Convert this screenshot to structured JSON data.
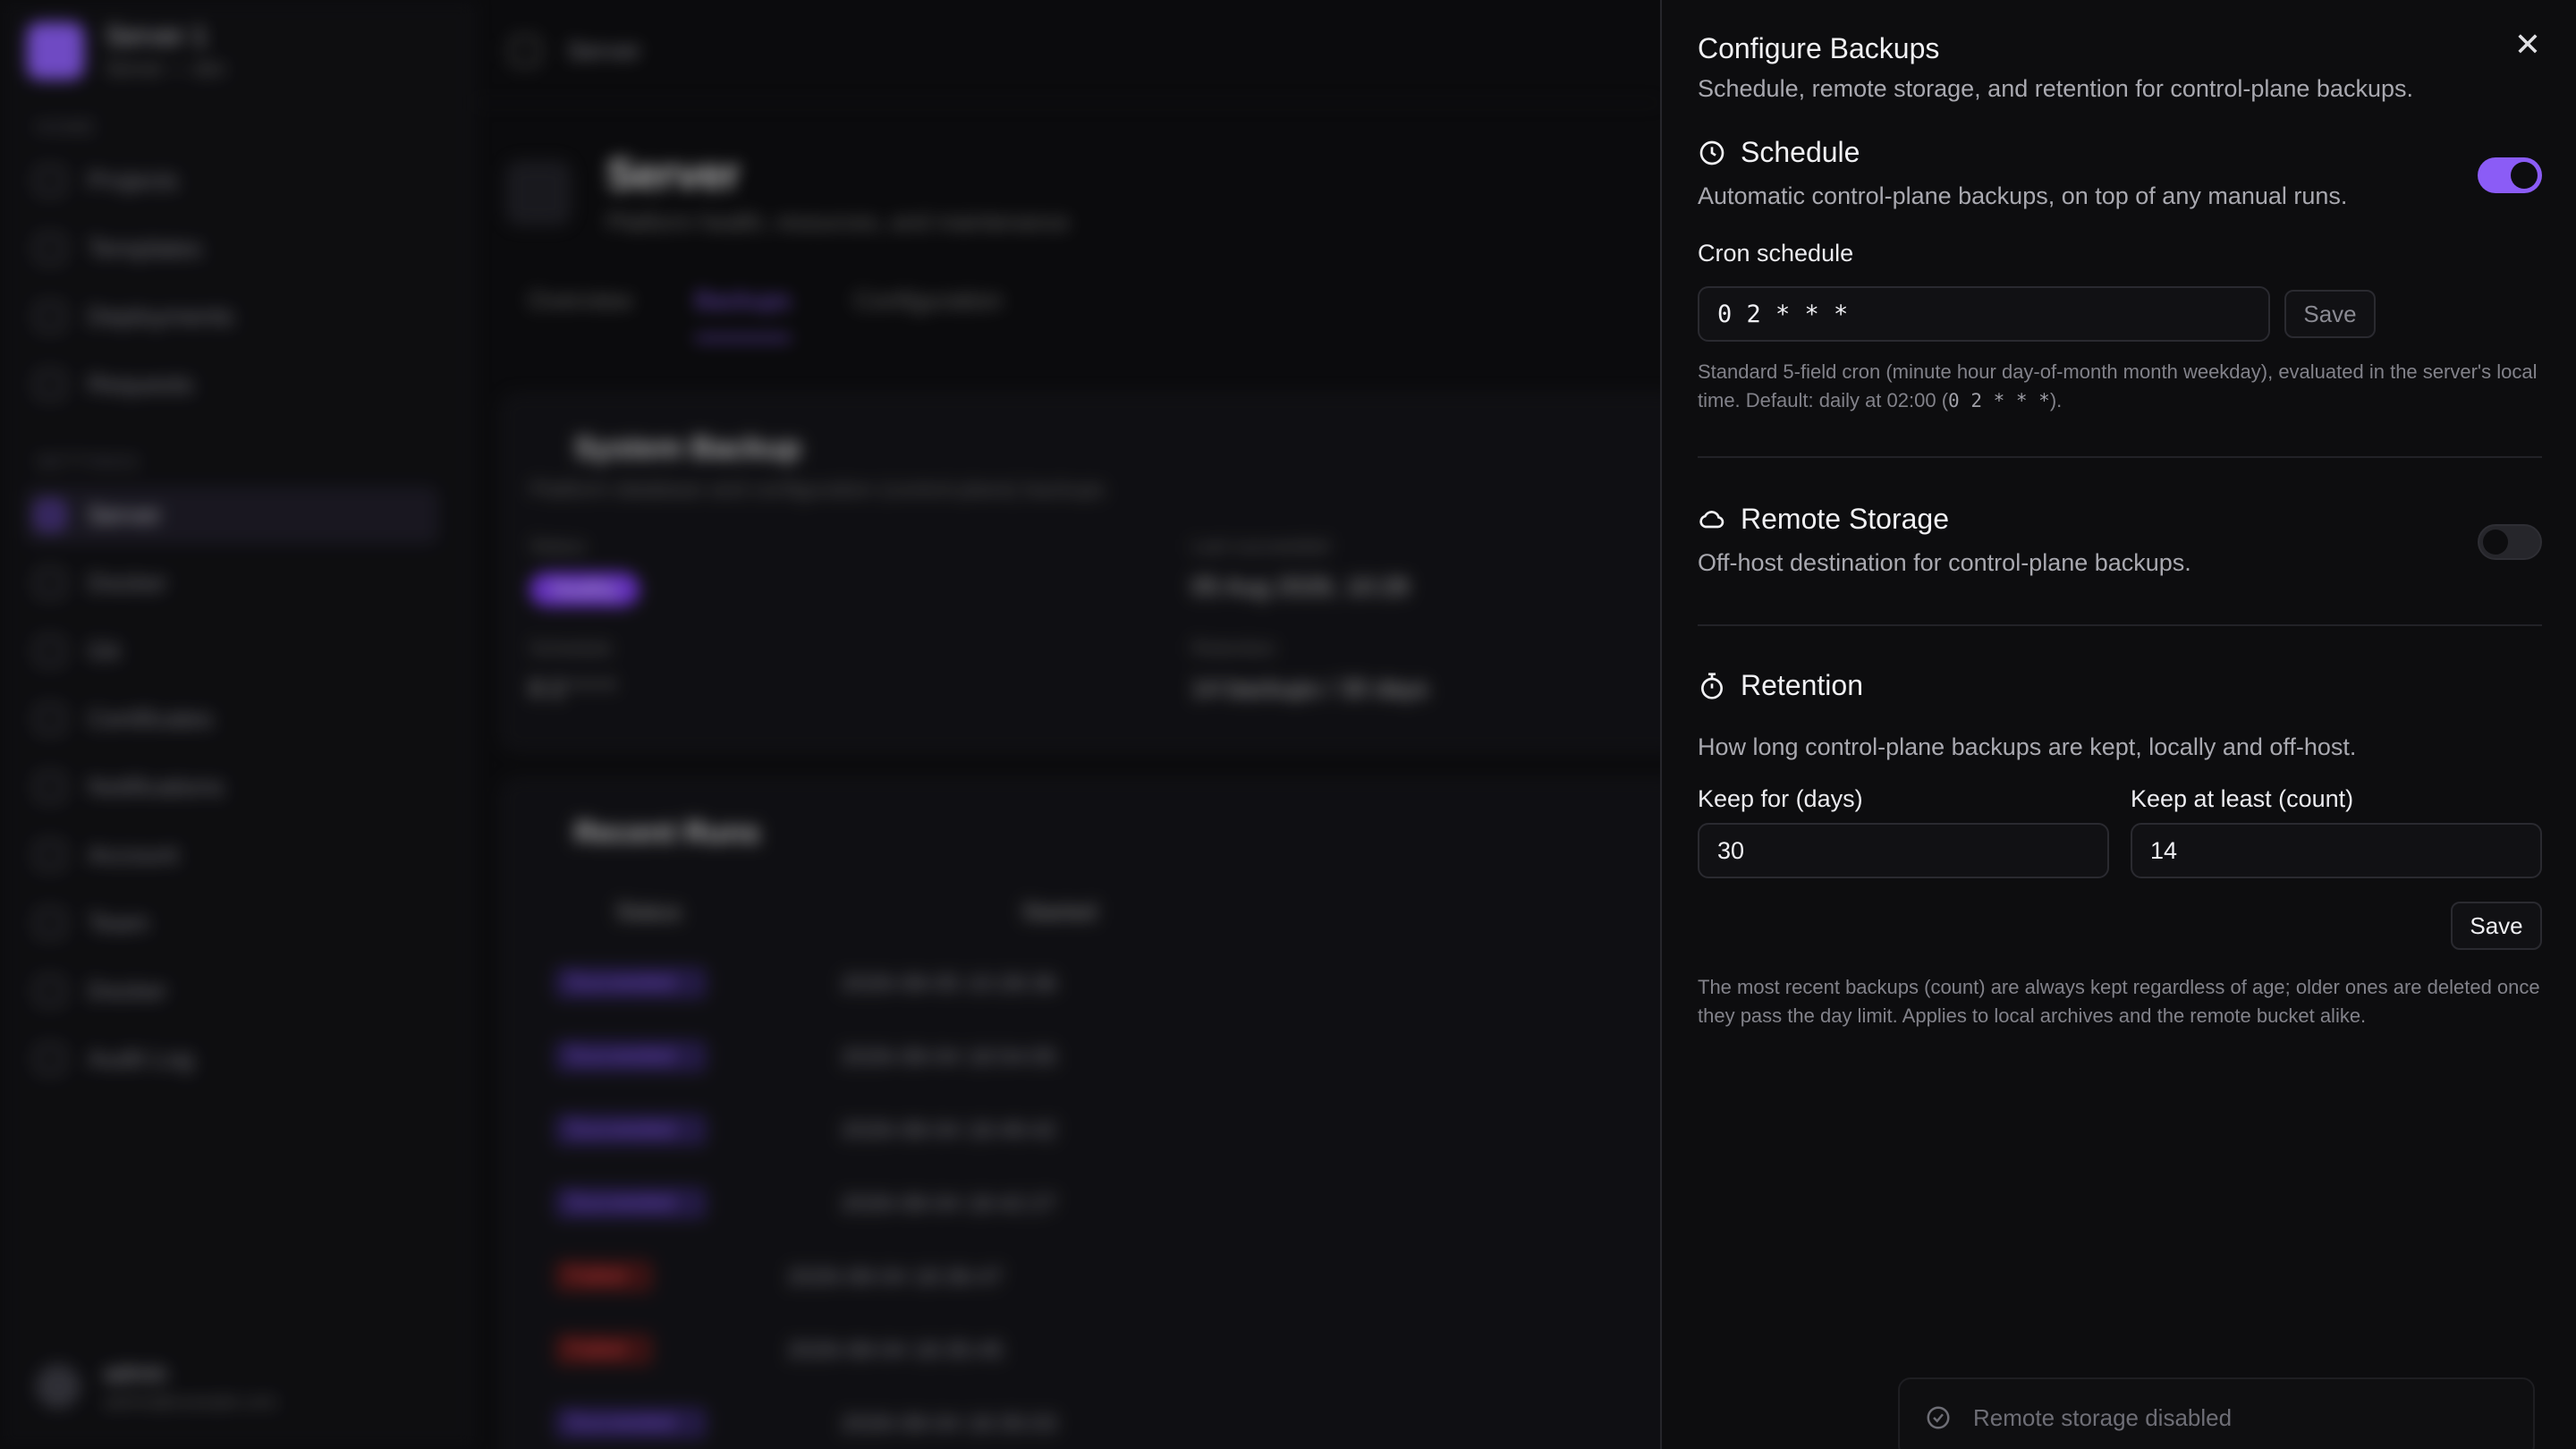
{
  "background": {
    "workspace": {
      "name": "Server 1",
      "sub": "Server — dev"
    },
    "sidebar": {
      "section_home": "HOME",
      "section_settings": "SETTINGS",
      "items_home": [
        {
          "label": "Projects",
          "icon": "folder-icon"
        },
        {
          "label": "Templates",
          "icon": "template-icon"
        },
        {
          "label": "Deployments",
          "icon": "rocket-icon"
        },
        {
          "label": "Requests",
          "icon": "request-icon"
        }
      ],
      "items_settings": [
        {
          "label": "Server",
          "icon": "server-icon"
        },
        {
          "label": "Docker",
          "icon": "docker-icon"
        },
        {
          "label": "Git",
          "icon": "git-icon"
        },
        {
          "label": "Certificates",
          "icon": "certificate-icon"
        },
        {
          "label": "Notifications",
          "icon": "bell-icon"
        },
        {
          "label": "Account",
          "icon": "user-icon"
        },
        {
          "label": "Team",
          "icon": "team-icon"
        },
        {
          "label": "Docker",
          "icon": "docker-icon"
        },
        {
          "label": "Audit Log",
          "icon": "log-icon"
        }
      ],
      "user": {
        "name": "admin",
        "email": "admin@example.com"
      }
    },
    "topbar": {
      "crumb": "Server"
    },
    "page": {
      "title": "Server",
      "subtitle": "Platform health, resources, and maintenance"
    },
    "tabs": [
      "Overview",
      "Backups",
      "Configuration"
    ],
    "system_backup": {
      "title": "System Backup",
      "subtitle": "Platform database and configuration (control-plane) backups",
      "status_label": "Status",
      "status_value": "Healthy",
      "last_label": "Last succeeded",
      "last_value": "05 Aug 2026, 10:28",
      "schedule_label": "Schedule",
      "schedule_value": "0 2 * * *",
      "retention_label": "Retention",
      "retention_value": "14 backups / 30 days"
    },
    "recent_runs": {
      "title": "Recent Runs",
      "col_status": "Status",
      "col_started": "Started",
      "rows": [
        {
          "status": "Succeeded",
          "started": "2026-08-05 10:28:36"
        },
        {
          "status": "Succeeded",
          "started": "2026-08-04 18:54:05"
        },
        {
          "status": "Succeeded",
          "started": "2026-08-04 18:49:42"
        },
        {
          "status": "Succeeded",
          "started": "2026-08-04 18:42:27"
        },
        {
          "status": "Failed",
          "started": "2026-08-04 18:36:47"
        },
        {
          "status": "Failed",
          "started": "2026-08-04 18:35:45"
        },
        {
          "status": "Succeeded",
          "started": "2026-08-04 18:35:03"
        }
      ]
    }
  },
  "drawer": {
    "title": "Configure Backups",
    "subtitle": "Schedule, remote storage, and retention for control-plane backups.",
    "close_icon": "close-icon",
    "schedule": {
      "title": "Schedule",
      "icon": "clock-icon",
      "description": "Automatic control-plane backups, on top of any manual runs.",
      "enabled": true,
      "cron_label": "Cron schedule",
      "cron_value": "0 2 * * *",
      "save_label": "Save",
      "help_1": "Standard 5-field cron (minute hour day-of-month month weekday), evaluated in the server's local time. Default: daily at 02:00 (",
      "help_code": "0 2 * * *",
      "help_2": ")."
    },
    "remote_storage": {
      "title": "Remote Storage",
      "icon": "cloud-icon",
      "description": "Off-host destination for control-plane backups.",
      "enabled": false
    },
    "retention": {
      "title": "Retention",
      "icon": "stopwatch-icon",
      "description": "How long control-plane backups are kept, locally and off-host.",
      "days_label": "Keep for (days)",
      "days_value": "30",
      "count_label": "Keep at least (count)",
      "count_value": "14",
      "save_label": "Save",
      "help": "The most recent backups (count) are always kept regardless of age; older ones are deleted once they pass the day limit. Applies to local archives and the remote bucket alike."
    },
    "status_bar": {
      "text": "Remote storage disabled",
      "icon": "check-circle-icon"
    },
    "accent_color": "#8b5cf6"
  }
}
